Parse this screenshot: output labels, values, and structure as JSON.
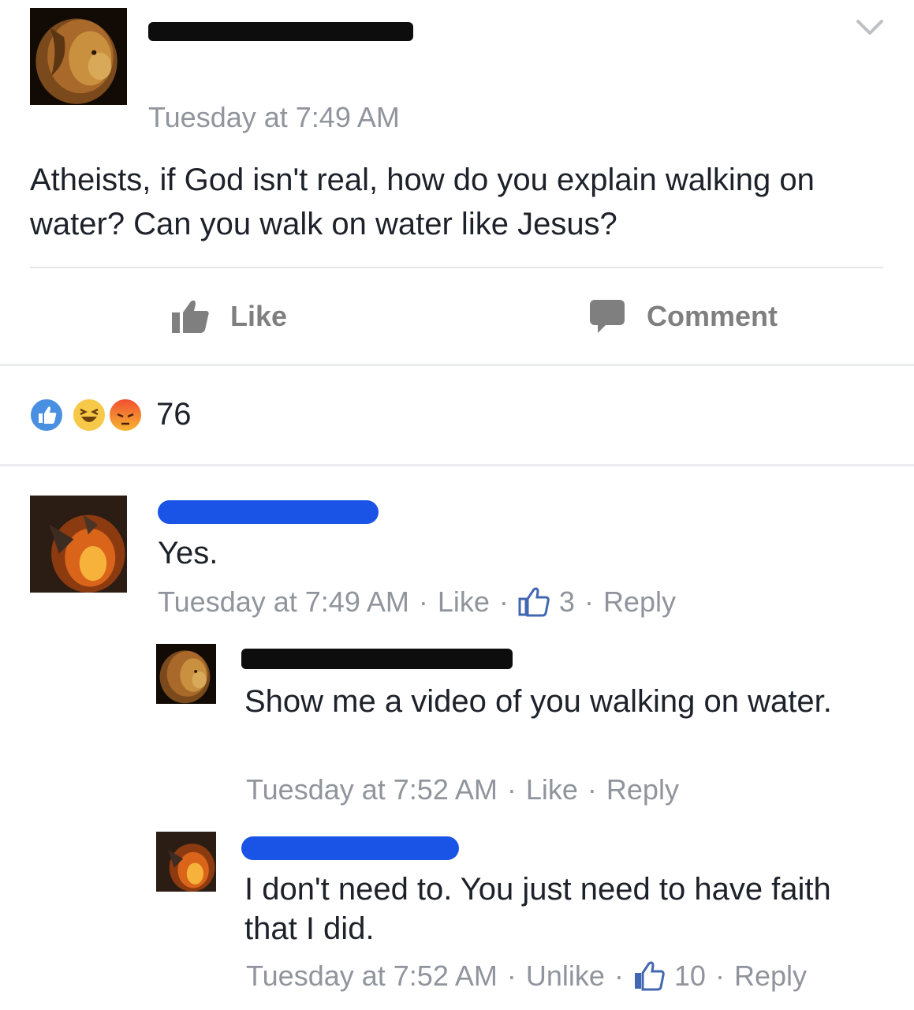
{
  "post": {
    "time": "Tuesday at 7:49 AM",
    "text": "Atheists, if God isn't real, how do you explain walking on water? Can you walk on water like Jesus?"
  },
  "actions": {
    "like_label": "Like",
    "comment_label": "Comment"
  },
  "reactions": {
    "count": "76",
    "types": [
      "like",
      "haha",
      "angry"
    ]
  },
  "comments": [
    {
      "text": "Yes.",
      "time": "Tuesday at 7:49 AM",
      "like_label": "Like",
      "likes": "3",
      "reply_label": "Reply"
    },
    {
      "text": "Show me a video of you walking on water.",
      "time": "Tuesday at 7:52 AM",
      "like_label": "Like",
      "reply_label": "Reply"
    },
    {
      "text": "I don't need to. You just need to have faith that I did.",
      "time": "Tuesday at 7:52 AM",
      "like_label": "Unlike",
      "likes": "10",
      "reply_label": "Reply"
    }
  ],
  "colors": {
    "like_blue": "#4267b2",
    "meta_gray": "#90949c",
    "redaction_blue": "#1a54e6"
  }
}
